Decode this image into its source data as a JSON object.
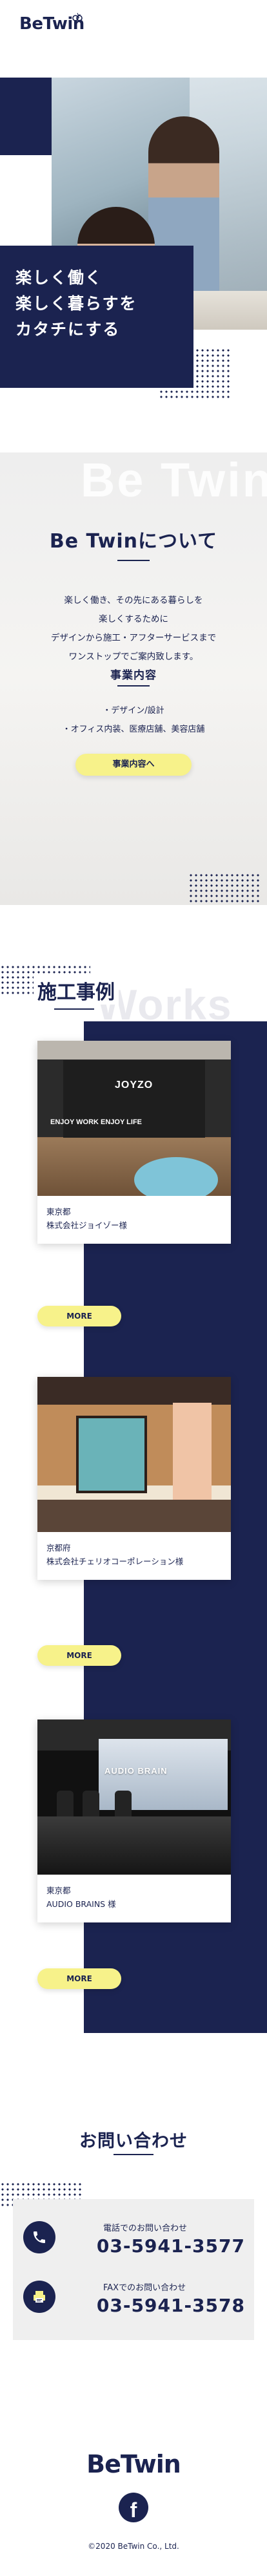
{
  "brand": {
    "logo_text": "BeTwin",
    "navy": "#1b2350",
    "accent_yellow": "#f7f28a"
  },
  "hero": {
    "line1": "楽しく働く",
    "line2": "楽しく暮らすを",
    "line3": "カタチにする"
  },
  "about": {
    "ghost_text": "Be Twin",
    "title": "Be Twinについて",
    "text_line1": "楽しく働き、その先にある暮らしを",
    "text_line2": "楽しくするために",
    "text_line3": "デザインから施工・アフターサービスまで",
    "text_line4": "ワンストップでご案内致します。",
    "business_title": "事業内容",
    "business_line1": "・デザイン/設計",
    "business_line2": "・オフィス内装、医療店舗、美容店舗",
    "button_label": "事業内容へ"
  },
  "works": {
    "title": "施工事例",
    "ghost_text": "Works",
    "cases": [
      {
        "pref": "東京都",
        "name": "株式会社ジョイゾー様",
        "photo_logo": "JOYZO",
        "photo_slogan": "ENJOY WORK ENJOY LIFE",
        "more_label": "MORE"
      },
      {
        "pref": "京都府",
        "name": "株式会社チェリオコーポレーション様",
        "more_label": "MORE"
      },
      {
        "pref": "東京都",
        "name": "AUDIO BRAINS 様",
        "photo_sign": "AUDIO BRAIN",
        "more_label": "MORE"
      }
    ]
  },
  "contact": {
    "title": "お問い合わせ",
    "tel_label": "電話でのお問い合わせ",
    "tel_number": "03-5941-3577",
    "fax_label": "FAXでのお問い合わせ",
    "fax_number": "03-5941-3578"
  },
  "footer": {
    "logo_text": "BeTwin",
    "facebook_glyph": "f",
    "copyright": "©2020 BeTwin Co., Ltd."
  }
}
